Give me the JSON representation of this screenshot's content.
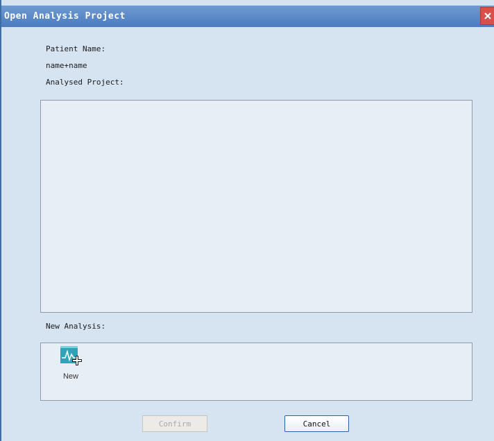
{
  "window": {
    "title": "Open Analysis Project"
  },
  "form": {
    "patient_name_label": "Patient Name:",
    "patient_name_value": "name+name",
    "analysed_project_label": "Analysed Project:",
    "new_analysis_label": "New Analysis:"
  },
  "analysed_projects": [],
  "new_analysis": {
    "item_label": "New",
    "icon": "new-analysis-icon"
  },
  "buttons": {
    "confirm": "Confirm",
    "cancel": "Cancel"
  },
  "colors": {
    "titlebar": "#4b7cc0",
    "body": "#d6e3f1",
    "close": "#d9504a",
    "icon": "#2fa3b8"
  }
}
